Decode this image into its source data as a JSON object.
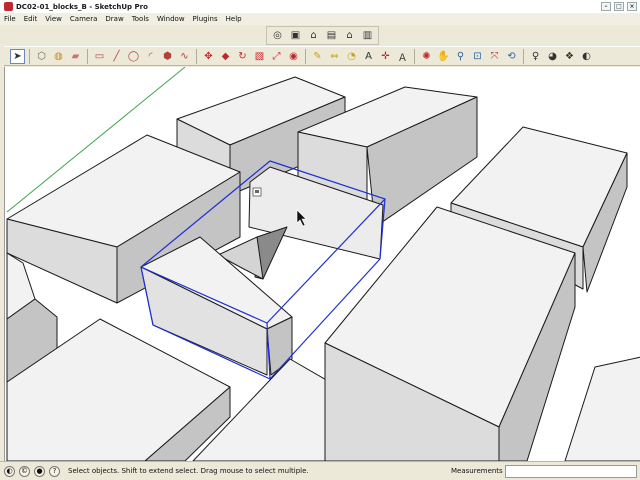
{
  "window": {
    "title": "DC02-01_blocks_B - SketchUp Pro"
  },
  "menu": [
    "File",
    "Edit",
    "View",
    "Camera",
    "Draw",
    "Tools",
    "Window",
    "Plugins",
    "Help"
  ],
  "camera_tools": [
    "orbit-icon",
    "pan-icon",
    "home-icon",
    "standard-view-icon",
    "house-icon",
    "front-view-icon"
  ],
  "main_tools": [
    "select-icon",
    "make-component-icon",
    "paint-bucket-icon",
    "eraser-icon",
    "rectangle-icon",
    "line-icon",
    "circle-icon",
    "arc-icon",
    "polygon-icon",
    "freehand-icon",
    "move-icon",
    "push-pull-icon",
    "rotate-icon",
    "follow-me-icon",
    "scale-icon",
    "offset-icon",
    "tape-measure-icon",
    "dimension-icon",
    "protractor-icon",
    "text-icon",
    "axes-icon",
    "3d-text-icon",
    "orbit-icon",
    "pan-icon",
    "zoom-icon",
    "zoom-window-icon",
    "zoom-extents-icon",
    "previous-view-icon",
    "position-camera-icon",
    "look-around-icon",
    "walk-icon",
    "section-plane-icon"
  ],
  "status": {
    "message": "Select objects. Shift to extend select. Drag mouse to select multiple.",
    "measurements_label": "Measurements",
    "measurements_value": ""
  },
  "colors": {
    "selection": "#1d2fd6",
    "edge": "#1a1a1a",
    "axis_green": "#3fa34d",
    "face_light": "#f2f2f2",
    "face_mid": "#dcdcdc",
    "face_dark": "#c4c4c4"
  }
}
